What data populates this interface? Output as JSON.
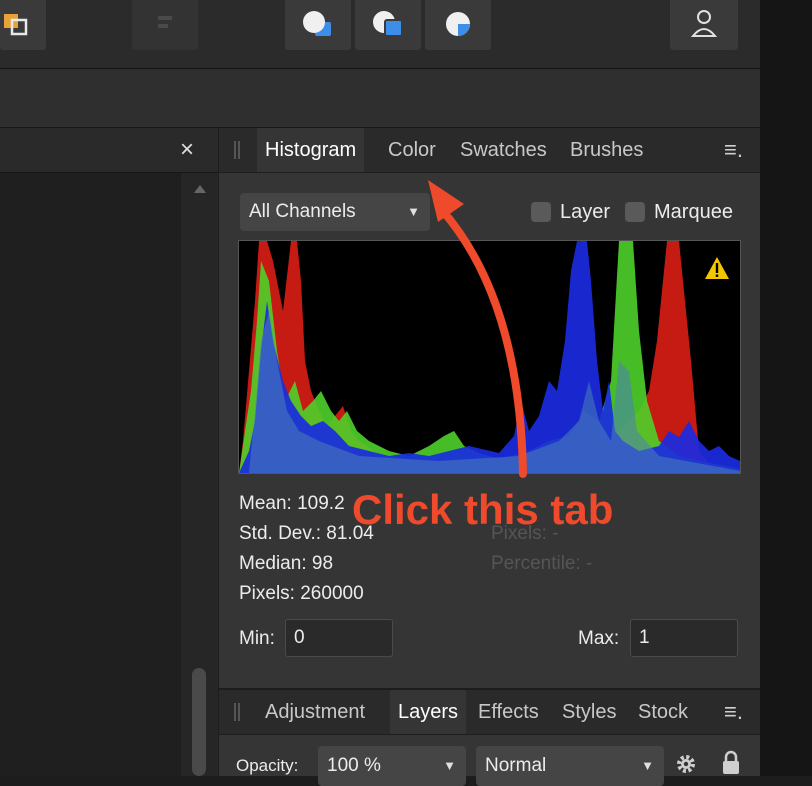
{
  "histogram_panel": {
    "tabs": [
      "Histogram",
      "Color",
      "Swatches",
      "Brushes"
    ],
    "active_tab": "Histogram",
    "channel_select": "All Channels",
    "layer_label": "Layer",
    "marquee_label": "Marquee",
    "stats": {
      "mean": "Mean: 109.2",
      "std_dev": "Std. Dev.: 81.04",
      "median": "Median: 98",
      "pixels": "Pixels: 260000",
      "sel_pixels": "Pixels: -",
      "percentile": "Percentile: -"
    },
    "min_label": "Min:",
    "min_value": "0",
    "max_label": "Max:",
    "max_value": "1"
  },
  "bottom_panel": {
    "tabs": [
      "Adjustment",
      "Layers",
      "Effects",
      "Styles",
      "Stock"
    ],
    "active_tab": "Layers",
    "opacity_label": "Opacity:",
    "opacity_value": "100 %",
    "blend_mode": "Normal"
  },
  "doc_close": "×",
  "annotation": "Click this tab",
  "colors": {
    "accent_arrow": "#ee4a2b",
    "warning": "#f2c600",
    "panel_bg": "#353535"
  }
}
